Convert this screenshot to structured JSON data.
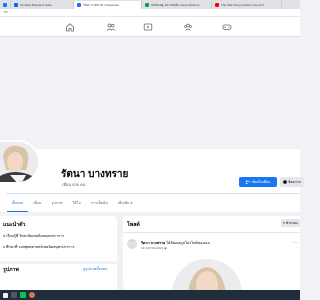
{
  "browser": {
    "tabs": [
      {
        "label": "",
        "color": "#1877f2"
      },
      {
        "label": "(6) Meta Business Suite",
        "color": "#0866ff"
      },
      {
        "label": "รัตนา บางทราย | Facebook",
        "color": "#1877f2",
        "active": true
      },
      {
        "label": "ขอร้องอยู่ Job ของฉัน (Joint Mt-Zone",
        "color": "#0f9d58"
      },
      {
        "label": "The Well Song (Nothin' Into a) P",
        "color": "#ff0000"
      }
    ],
    "address": "ฯลฯ"
  },
  "profile": {
    "name": "รัตนา บางทราย",
    "friends": "เพื่อน 636 คน",
    "add_friend_label": "เพิ่มเป็นเพื่อน",
    "message_label": "ข้อความ"
  },
  "profile_tabs": [
    "ทั้งหมด",
    "เพื่อน",
    "รูปภาพ",
    "วิดีโอ",
    "การเช็คอิน",
    "เพิ่มเติม"
  ],
  "intro": {
    "title": "แนะนำตัว",
    "line1": "เรียนรู้ที่ วิทยาลัยเทคนิคสมุทรปราการ",
    "line2": "ศึกษาที่ รอสพุทธศาสตร์เทคนิคสมุทรปราการ"
  },
  "photos": {
    "title": "รูปภาพ",
    "see_all": "ดูรูปภาพทั้งหมด"
  },
  "posts": {
    "title": "โพสต์",
    "filter_label": "ตัวกรอง",
    "author": "รัตนา บางทราย",
    "action": "ได้อัพเดตรูปโปรไฟล์ของเธอ",
    "date": "14 เมษายน 2021"
  },
  "colors": {
    "accent": "#1877f2",
    "page_bg": "#f0f2f5",
    "taskbar": "#1f2d3d"
  },
  "icons": [
    "home-icon",
    "friends-icon",
    "watch-icon",
    "groups-icon",
    "gaming-icon"
  ],
  "taskbar_icons": [
    "windows-icon",
    "search-icon",
    "line-app-icon",
    "chrome-icon"
  ]
}
